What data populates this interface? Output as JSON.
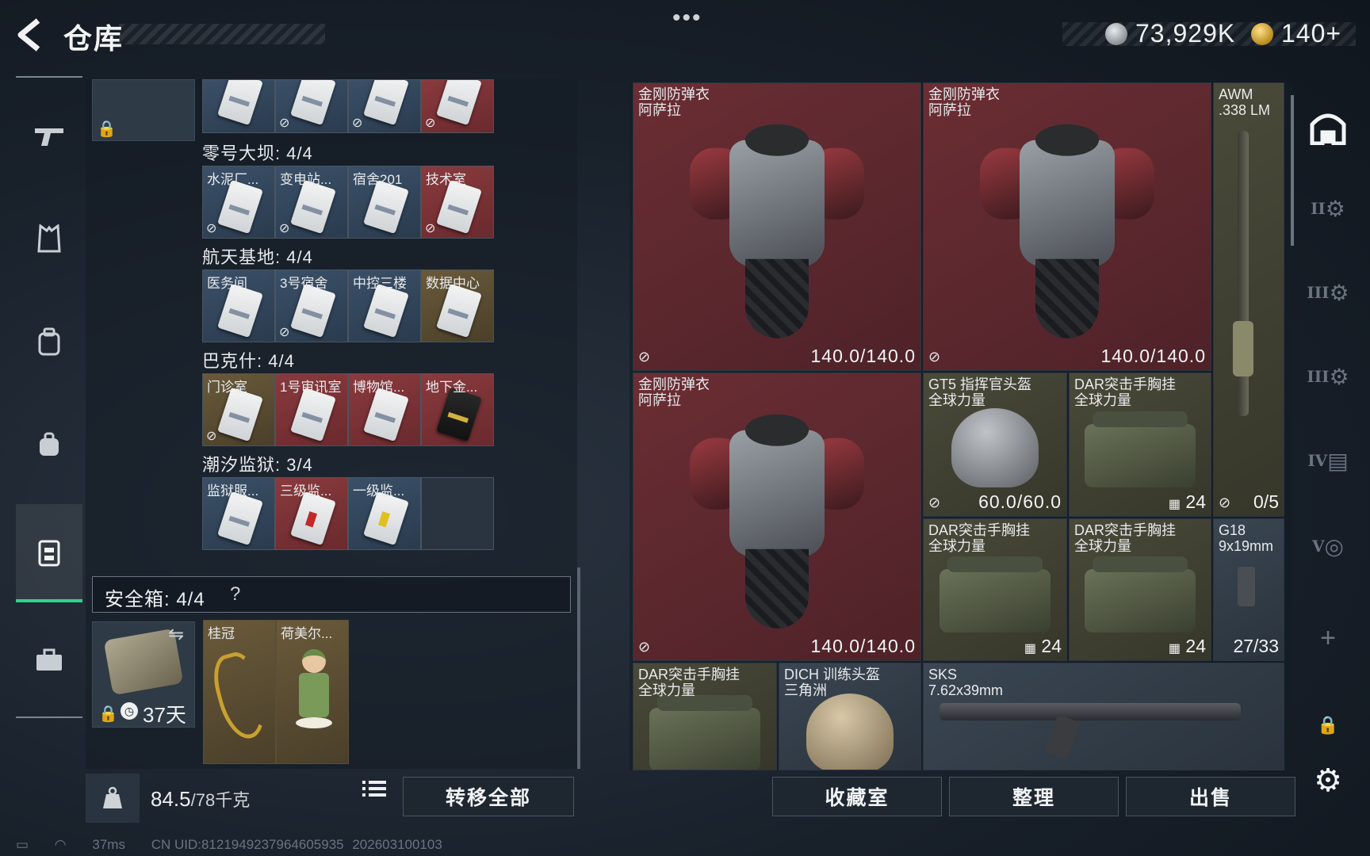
{
  "header": {
    "title": "仓库",
    "currency_silver": "73,929K",
    "currency_gold": "140+"
  },
  "sidebar": {
    "items": [
      {
        "name": "weapons",
        "icon": "rifle-icon"
      },
      {
        "name": "vest",
        "icon": "vest-icon"
      },
      {
        "name": "backpack",
        "icon": "backpack-icon"
      },
      {
        "name": "bag",
        "icon": "bag-icon"
      },
      {
        "name": "safe-case",
        "icon": "case-icon"
      },
      {
        "name": "toolbox",
        "icon": "toolbox-icon"
      }
    ]
  },
  "inventory": {
    "regions": [
      {
        "label": "零号大坝: 4/4",
        "cards": [
          {
            "name": "水泥厂...",
            "color": "blue",
            "flag": true
          },
          {
            "name": "变电站...",
            "color": "blue",
            "flag": true
          },
          {
            "name": "宿舍201",
            "color": "blue",
            "flag": false
          },
          {
            "name": "技术室",
            "color": "red",
            "flag": true
          }
        ]
      },
      {
        "label": "航天基地: 4/4",
        "cards": [
          {
            "name": "医务间",
            "color": "blue",
            "flag": false
          },
          {
            "name": "3号宿舍",
            "color": "blue",
            "flag": true
          },
          {
            "name": "中控三楼",
            "color": "blue",
            "flag": false
          },
          {
            "name": "数据中心",
            "color": "gold",
            "flag": false
          }
        ]
      },
      {
        "label": "巴克什: 4/4",
        "cards": [
          {
            "name": "门诊室",
            "color": "gold",
            "flag": true
          },
          {
            "name": "1号审讯室",
            "color": "red",
            "flag": false
          },
          {
            "name": "博物馆...",
            "color": "red",
            "flag": false
          },
          {
            "name": "地下金...",
            "color": "red",
            "flag": false
          }
        ]
      },
      {
        "label": "潮汐监狱: 3/4",
        "cards": [
          {
            "name": "监狱服...",
            "color": "blue",
            "flag": false
          },
          {
            "name": "三级监...",
            "color": "red",
            "flag": false
          },
          {
            "name": "一级监...",
            "color": "blue",
            "flag": false
          },
          {
            "name": "",
            "color": "empty",
            "flag": false
          }
        ]
      }
    ],
    "safe": {
      "label": "安全箱: 4/4",
      "help": "?",
      "days": "37天",
      "items": [
        {
          "name": "桂冠"
        },
        {
          "name": "荷美尔..."
        }
      ]
    },
    "weight_value": "84.5",
    "weight_max": "/78千克",
    "transfer_all_label": "转移全部"
  },
  "stash": {
    "armor1": {
      "name": "金刚防弹衣\n阿萨拉",
      "durability": "140.0/140.0"
    },
    "armor2": {
      "name": "金刚防弹衣\n阿萨拉",
      "durability": "140.0/140.0"
    },
    "armor3": {
      "name": "金刚防弹衣\n阿萨拉",
      "durability": "140.0/140.0"
    },
    "awm": {
      "name": "AWM\n.338 LM",
      "ammo": "0/5"
    },
    "helmet_gt5": {
      "name": "GT5 指挥官头盔\n全球力量",
      "durability": "60.0/60.0"
    },
    "rig1": {
      "name": "DAR突击手胸挂\n全球力量",
      "capacity": "24"
    },
    "rig2": {
      "name": "DAR突击手胸挂\n全球力量",
      "capacity": "24"
    },
    "rig3": {
      "name": "DAR突击手胸挂\n全球力量",
      "capacity": "24"
    },
    "rig4": {
      "name": "DAR突击手胸挂\n全球力量"
    },
    "g18": {
      "name": "G18\n9x19mm",
      "ammo": "27/33"
    },
    "helmet_dich": {
      "name": "DICH 训练头盔\n三角洲"
    },
    "sks": {
      "name": "SKS\n7.62x39mm"
    }
  },
  "actions": {
    "collection_label": "收藏室",
    "sort_label": "整理",
    "sell_label": "出售"
  },
  "rail": {
    "labels": [
      "II",
      "III",
      "III",
      "IV",
      "V"
    ]
  },
  "status": {
    "ping": "37ms",
    "uid": "CN UID:8121949237964605935",
    "build": "202603100103"
  }
}
